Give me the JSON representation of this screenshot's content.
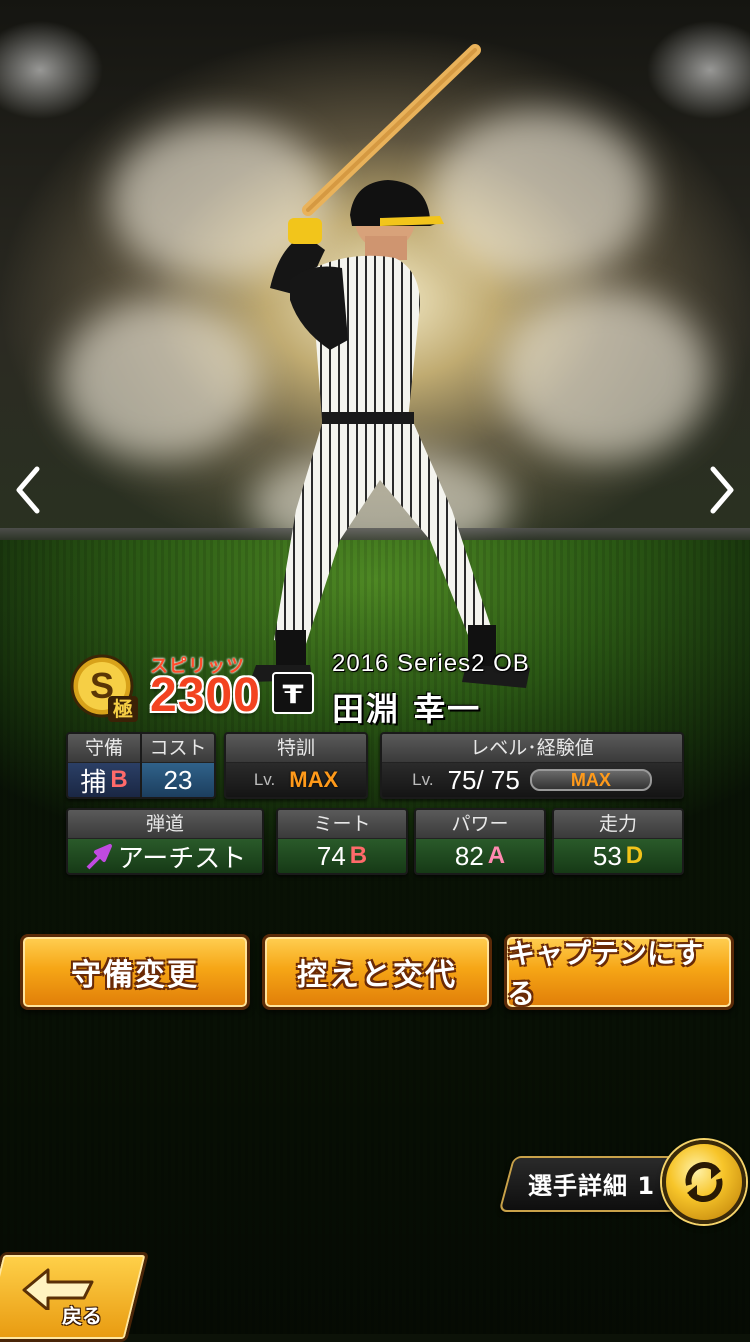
{
  "card": {
    "rarity_letter": "S",
    "rarity_sub": "極",
    "spirits_label": "スピリッツ",
    "spirits_value": "2300",
    "team_logo_text": "T",
    "series": "2016 Series2 OB",
    "player_name": "田淵 幸一"
  },
  "stats": {
    "position": {
      "header": "守備",
      "value": "捕",
      "grade": "B"
    },
    "cost": {
      "header": "コスト",
      "value": "23"
    },
    "training": {
      "header": "特訓",
      "lv_prefix": "Lv.",
      "value": "MAX"
    },
    "level": {
      "header": "レベル･経験値",
      "lv_prefix": "Lv.",
      "value": "75/ 75",
      "bar_label": "MAX"
    },
    "trajectory": {
      "header": "弾道",
      "value": "アーチスト"
    },
    "contact": {
      "header": "ミート",
      "value": "74",
      "grade": "B"
    },
    "power": {
      "header": "パワー",
      "value": "82",
      "grade": "A"
    },
    "speed": {
      "header": "走力",
      "value": "53",
      "grade": "D"
    }
  },
  "actions": {
    "change_position": "守備変更",
    "swap_bench": "控えと交代",
    "make_captain": "キャプテンにする"
  },
  "detail": {
    "label": "選手詳細 1"
  },
  "back": {
    "label": "戻る"
  },
  "icons": {
    "prev": "chevron-left-icon",
    "next": "chevron-right-icon",
    "swap": "rotate-arrows-icon",
    "back": "back-arrow-icon",
    "trajectory": "diagonal-arrow-icon"
  },
  "colors": {
    "button_orange": "#f6a616",
    "grade_B": "#ff6a6a",
    "grade_A": "#ff8ab0",
    "grade_D": "#f2c31a",
    "max_orange": "#ff9a1a",
    "trajectory_purple": "#c04ae0"
  }
}
